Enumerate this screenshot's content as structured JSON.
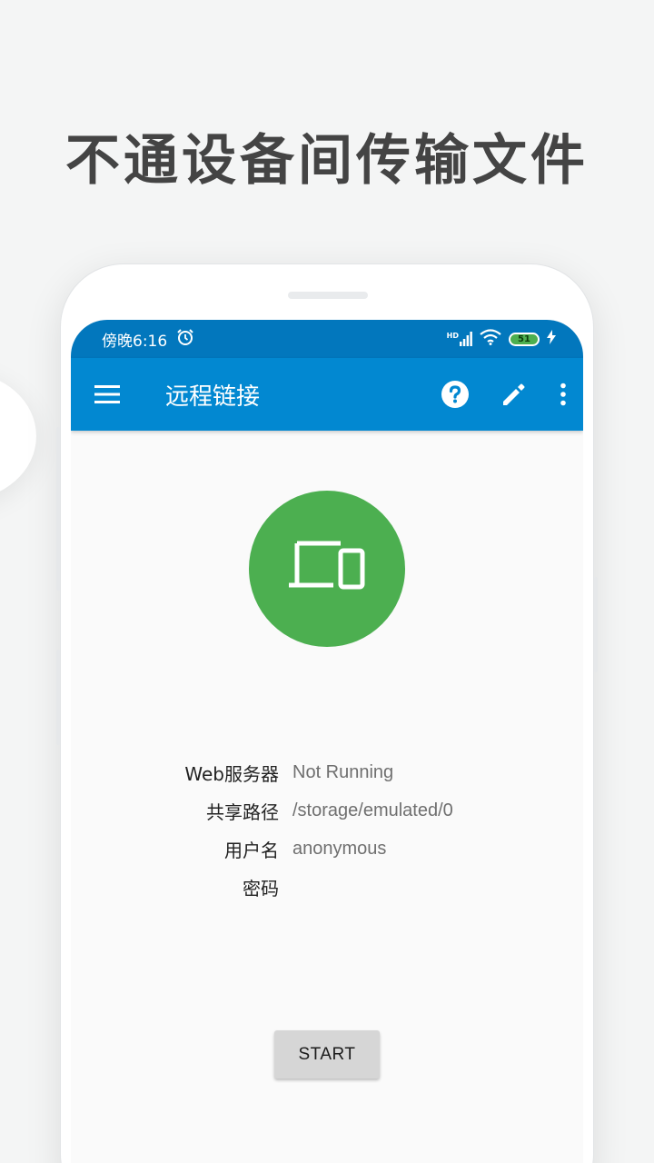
{
  "headline": "不通设备间传输文件",
  "status_bar": {
    "time": "傍晚6:16",
    "network_label": "HD",
    "battery_level": "51"
  },
  "app_bar": {
    "title": "远程链接",
    "icons": [
      "menu-icon",
      "help-icon",
      "edit-icon",
      "more-vert-icon"
    ]
  },
  "hero": {
    "icon": "devices-icon",
    "color": "#4caf50"
  },
  "info_rows": [
    {
      "label": "Web服务器",
      "value": "Not Running"
    },
    {
      "label": "共享路径",
      "value": "/storage/emulated/0"
    },
    {
      "label": "用户名",
      "value": "anonymous"
    },
    {
      "label": "密码",
      "value": ""
    }
  ],
  "start_button": {
    "label": "START"
  },
  "colors": {
    "status_bar": "#0277bd",
    "app_bar": "#0288d1",
    "accent_green": "#4caf50",
    "headline": "#444444"
  }
}
